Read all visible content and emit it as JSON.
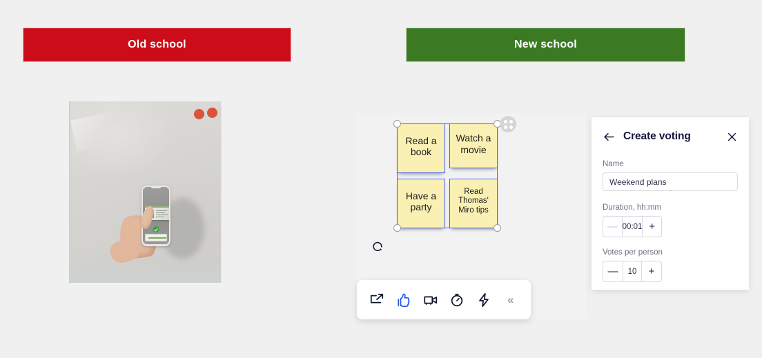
{
  "banners": {
    "old": "Old school",
    "new": "New school",
    "old_color": "#cc0c18",
    "new_color": "#3b7a22"
  },
  "photo": {
    "alt_description": "hand holding phone scanning an ID card on a whiteboard",
    "dots": [
      "voting-dot",
      "voting-dot"
    ],
    "dot_color": "#d9543a"
  },
  "board": {
    "background": "#f2f2f2",
    "selection_color": "#4262ff",
    "note_color": "#faf0b4",
    "notes": [
      {
        "text": "Read a book"
      },
      {
        "text": "Watch a movie"
      },
      {
        "text": "Have a party"
      },
      {
        "text": "Read Thomas' Miro tips"
      }
    ],
    "drag_handle_icon": "grid-dots-icon",
    "rotate_icon": "rotate-icon"
  },
  "toolbar": {
    "items": [
      {
        "icon": "share-screen-icon",
        "active": false
      },
      {
        "icon": "thumbs-up-icon",
        "active": true
      },
      {
        "icon": "video-camera-icon",
        "active": false
      },
      {
        "icon": "timer-icon",
        "active": false
      },
      {
        "icon": "lightning-bolt-icon",
        "active": false
      },
      {
        "icon": "collapse-chevrons-icon",
        "label": "«",
        "active": false
      }
    ],
    "active_color": "#2b5ce6"
  },
  "panel": {
    "title": "Create voting",
    "back_icon": "arrow-left-icon",
    "close_icon": "close-icon",
    "name": {
      "label": "Name",
      "value": "Weekend plans",
      "placeholder": "Voting name"
    },
    "duration": {
      "label": "Duration, hh:mm",
      "value": "00:01",
      "minus": "—",
      "plus": "+",
      "minus_disabled": true
    },
    "votes": {
      "label": "Votes per person",
      "value": "10",
      "minus": "—",
      "plus": "+",
      "minus_disabled": false
    }
  }
}
